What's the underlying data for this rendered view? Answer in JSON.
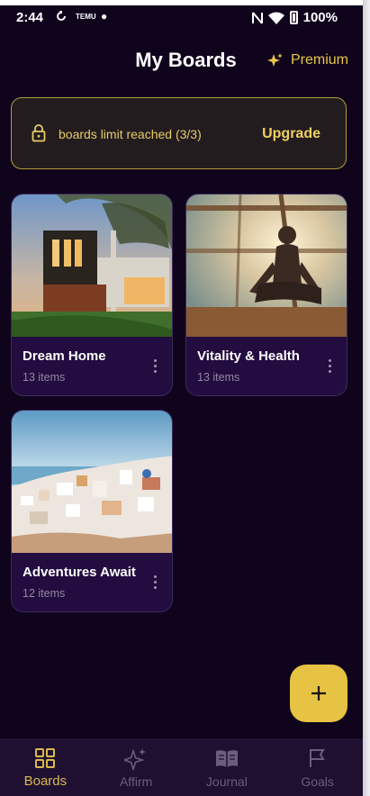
{
  "status_bar": {
    "time": "2:44",
    "battery": "100%",
    "temu_glyph": "TEMU"
  },
  "header": {
    "title": "My Boards",
    "premium_label": "Premium"
  },
  "limit_banner": {
    "text": "boards limit reached (3/3)",
    "action": "Upgrade"
  },
  "boards": [
    {
      "title": "Dream Home",
      "count": "13 items"
    },
    {
      "title": "Vitality & Health",
      "count": "13 items"
    },
    {
      "title": "Adventures Await",
      "count": "12 items"
    }
  ],
  "nav": [
    {
      "label": "Boards",
      "icon": "grid-icon",
      "active": true
    },
    {
      "label": "Affirm",
      "icon": "sparkle-icon",
      "active": false
    },
    {
      "label": "Journal",
      "icon": "book-icon",
      "active": false
    },
    {
      "label": "Goals",
      "icon": "flag-icon",
      "active": false
    }
  ],
  "colors": {
    "accent": "#e7c344",
    "background": "#0f041c",
    "card": "#230c3f"
  }
}
